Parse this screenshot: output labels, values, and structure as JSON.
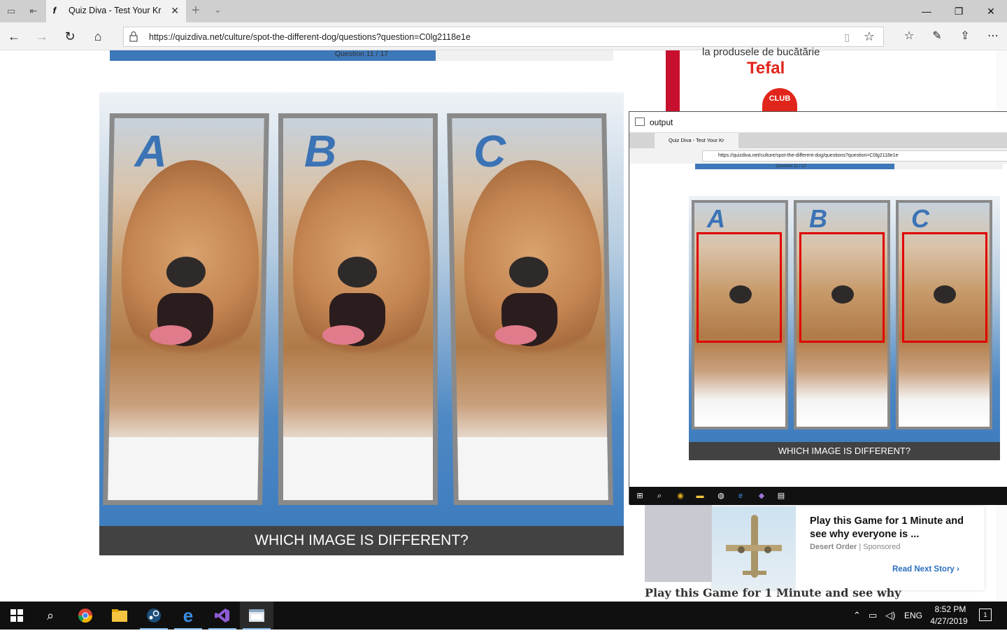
{
  "browser": {
    "tab_title": "Quiz Diva - Test Your Kr",
    "url": "https://quizdiva.net/culture/spot-the-different-dog/questions?question=C0lg2118e1e"
  },
  "quiz": {
    "progress_label": "Question 11 / 17",
    "progress_fraction": 0.647,
    "panel_letters": [
      "A",
      "B",
      "C"
    ],
    "question_text": "WHICH IMAGE IS DIFFERENT?"
  },
  "ad_tefal": {
    "tagline": "la produsele de bucătărie",
    "brand": "Tefal",
    "club": "CLUB"
  },
  "sponsored": {
    "title": "Play this Game for 1 Minute and see why everyone is ...",
    "source": "Desert Order",
    "label": "Sponsored",
    "read_next": "Read Next Story",
    "next_story_heading": "Play this Game for 1 Minute and see why"
  },
  "output_window": {
    "title": "output",
    "tab_title": "Quiz Diva - Test Your Kr",
    "url": "https://quizdiva.net/culture/spot-the-different-dog/questions?question=C0lg2118e1e",
    "progress_label": "Question 11 / 17",
    "question_text": "WHICH IMAGE IS DIFFERENT?"
  },
  "taskbar": {
    "language": "ENG",
    "time": "8:52 PM",
    "date": "4/27/2019",
    "notification_count": "1"
  },
  "icons": [
    "windows-start-icon",
    "search-icon",
    "chrome-icon",
    "file-explorer-icon",
    "steam-icon",
    "edge-icon",
    "visual-studio-icon",
    "output-app-icon"
  ]
}
